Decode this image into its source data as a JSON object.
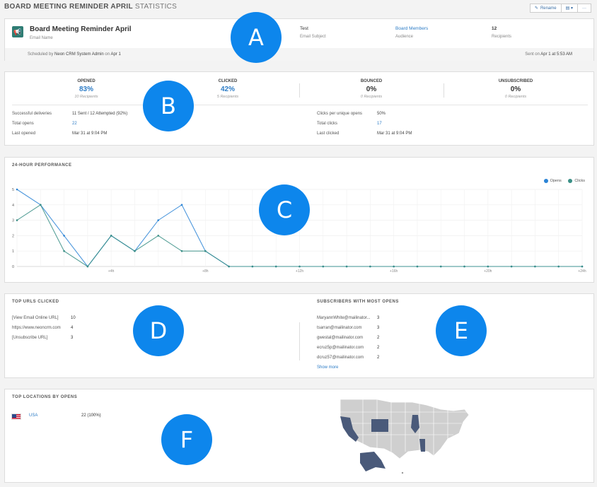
{
  "header": {
    "title_bold": "BOARD MEETING REMINDER APRIL",
    "title_light": "STATISTICS",
    "rename_label": "Rename",
    "copy_icon": "copy-icon",
    "more_label": "···"
  },
  "summary": {
    "email_name": "Board Meeting Reminder April",
    "email_name_caption": "Email Name",
    "subject": "Test",
    "subject_caption": "Email Subject",
    "audience": "Board Members",
    "audience_caption": "Audience",
    "recipients": "12",
    "recipients_caption": "Recipients",
    "scheduled_prefix": "Scheduled by",
    "scheduled_by": "Neon CRM System Admin",
    "scheduled_on_word": "on",
    "scheduled_date": "Apr 1",
    "sent_prefix": "Sent on",
    "sent_date": "Apr 1 at 5:53 AM"
  },
  "stats": {
    "opened": {
      "label": "OPENED",
      "pct": "83%",
      "sub": "10 Recipients"
    },
    "clicked": {
      "label": "CLICKED",
      "pct": "42%",
      "sub": "5 Recipients"
    },
    "bounced": {
      "label": "BOUNCED",
      "pct": "0%",
      "sub": "0 Recipients"
    },
    "unsubscribed": {
      "label": "UNSUBSCRIBED",
      "pct": "0%",
      "sub": "0 Recipients"
    },
    "details_left": [
      {
        "label": "Successful deliveries",
        "value": "11 Sent / 12 Attempted (92%)",
        "link": false
      },
      {
        "label": "Total opens",
        "value": "22",
        "link": true
      },
      {
        "label": "Last opened",
        "value": "Mar 31 at 9:04 PM",
        "link": false
      }
    ],
    "details_right": [
      {
        "label": "Clicks per unique opens",
        "value": "50%",
        "link": false
      },
      {
        "label": "Total clicks",
        "value": "17",
        "link": true
      },
      {
        "label": "Last clicked",
        "value": "Mar 31 at 9:04 PM",
        "link": false
      }
    ]
  },
  "performance": {
    "title": "24-HOUR PERFORMANCE",
    "legend_opens": "Opens",
    "legend_clicks": "Clicks",
    "color_opens": "#2b84d6",
    "color_clicks": "#3a8f86"
  },
  "chart_data": {
    "type": "line",
    "title": "24-HOUR PERFORMANCE",
    "x": [
      0,
      1,
      2,
      3,
      4,
      5,
      6,
      7,
      8,
      9,
      10,
      11,
      12,
      13,
      14,
      15,
      16,
      17,
      18,
      19,
      20,
      21,
      22,
      23,
      24
    ],
    "x_tick_labels": [
      {
        "x": 4,
        "label": "+4h"
      },
      {
        "x": 8,
        "label": "+8h"
      },
      {
        "x": 12,
        "label": "+12h"
      },
      {
        "x": 16,
        "label": "+16h"
      },
      {
        "x": 20,
        "label": "+20h"
      },
      {
        "x": 24,
        "label": "+24h"
      }
    ],
    "y_ticks": [
      0,
      1,
      2,
      3,
      4,
      5
    ],
    "ylim": [
      0,
      5
    ],
    "legend": "top-right",
    "grid": true,
    "series": [
      {
        "name": "Opens",
        "values": [
          5,
          4,
          2,
          0,
          2,
          1,
          3,
          4,
          1,
          0,
          0,
          0,
          0,
          0,
          0,
          0,
          0,
          0,
          0,
          0,
          0,
          0,
          0,
          0,
          0
        ]
      },
      {
        "name": "Clicks",
        "values": [
          3,
          4,
          1,
          0,
          2,
          1,
          2,
          1,
          1,
          0,
          0,
          0,
          0,
          0,
          0,
          0,
          0,
          0,
          0,
          0,
          0,
          0,
          0,
          0,
          0
        ]
      }
    ]
  },
  "top_urls": {
    "title": "TOP URLS CLICKED",
    "rows": [
      {
        "url": "[View Email Online URL]",
        "count": "10"
      },
      {
        "url": "https://www.neoncrm.com",
        "count": "4"
      },
      {
        "url": "[Unsubscribe URL]",
        "count": "3"
      }
    ]
  },
  "subscribers": {
    "title": "SUBSCRIBERS WITH MOST OPENS",
    "rows": [
      {
        "email": "MaryannWhite@mailinator...",
        "count": "3"
      },
      {
        "email": "tsarran@mailinator.com",
        "count": "3"
      },
      {
        "email": "gwestal@mailinator.com",
        "count": "2"
      },
      {
        "email": "ecruz5p@mailinator.com",
        "count": "2"
      },
      {
        "email": "dcruz57@mailinator.com",
        "count": "2"
      }
    ],
    "show_more": "Show more"
  },
  "locations": {
    "title": "TOP LOCATIONS BY OPENS",
    "country": "USA",
    "value": "22 (100%)",
    "flag_icon": "us-flag-icon"
  },
  "annotations": [
    "A",
    "B",
    "C",
    "D",
    "E",
    "F"
  ]
}
